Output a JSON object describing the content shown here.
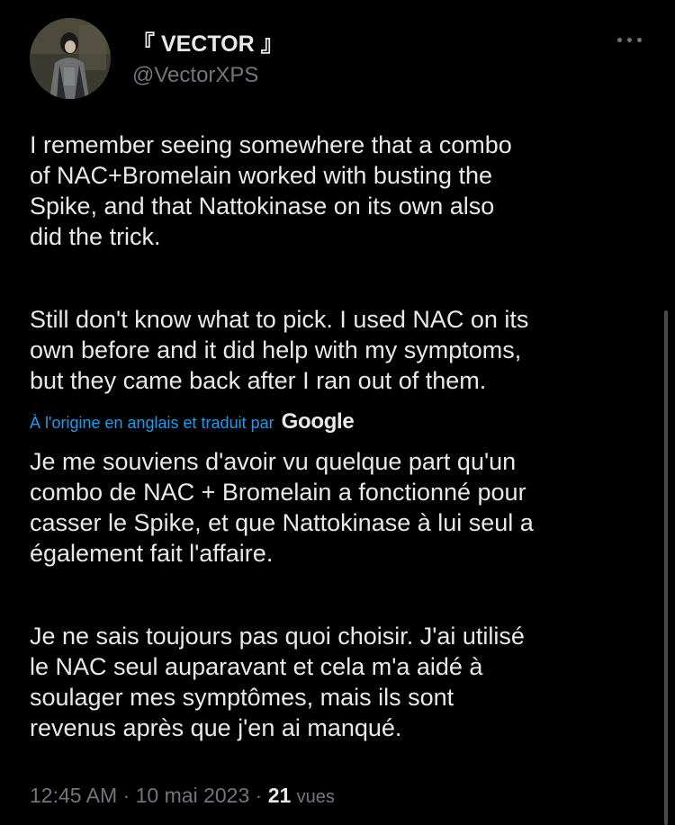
{
  "author": {
    "display_name": "『 VECTOR 』",
    "handle": "@VectorXPS"
  },
  "tweet": {
    "original_paragraphs": [
      "I remember seeing somewhere that a combo\nof NAC+Bromelain worked with busting the\nSpike, and that Nattokinase on its own also\ndid the trick.",
      "Still don't know what to pick. I used NAC on its\nown before and it did help with my symptoms,\nbut they came back after I ran out of them."
    ],
    "translation_note": "À l'origine en anglais et traduit par",
    "translation_provider": "Google",
    "translated_paragraphs": [
      "Je me souviens d'avoir vu quelque part qu'un\ncombo de NAC + Bromelain a fonctionné pour\ncasser le Spike, et que Nattokinase à lui seul a\négalement fait l'affaire.",
      "Je ne sais toujours pas quoi choisir. J'ai utilisé\nle NAC seul auparavant et cela m'a aidé à\nsoulager mes symptômes, mais ils sont\nrevenus après que j'en ai manqué."
    ]
  },
  "meta": {
    "time": "12:45 AM",
    "separator": "·",
    "date": "10 mai 2023",
    "views_count": "21",
    "views_label": "vues"
  },
  "icons": {
    "more": "more-horizontal-icon"
  },
  "colors": {
    "background": "#000000",
    "text_primary": "#e7e9ea",
    "text_secondary": "#71767b",
    "link": "#1d9bf0"
  }
}
